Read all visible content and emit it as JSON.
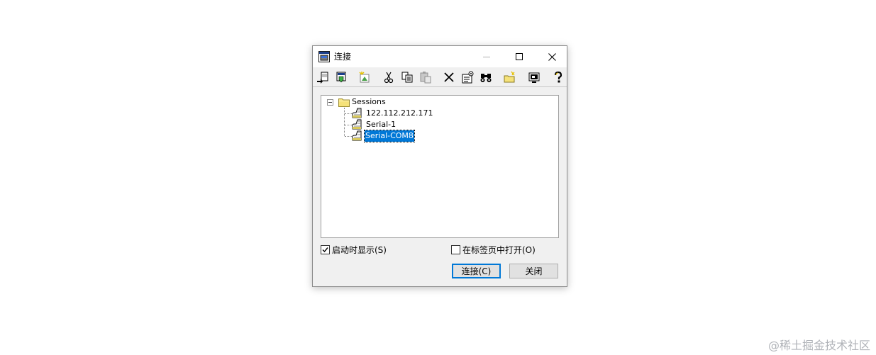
{
  "window": {
    "title": "连接"
  },
  "toolbar": {
    "buttons": [
      {
        "icon": "quick-connect-icon",
        "tooltip": ""
      },
      {
        "icon": "connect-tab-icon",
        "tooltip": ""
      },
      {
        "icon": "new-session-icon",
        "tooltip": ""
      },
      {
        "icon": "cut-icon",
        "tooltip": ""
      },
      {
        "icon": "copy-icon",
        "tooltip": ""
      },
      {
        "icon": "paste-icon",
        "tooltip": ""
      },
      {
        "icon": "delete-icon",
        "tooltip": ""
      },
      {
        "icon": "properties-icon",
        "tooltip": ""
      },
      {
        "icon": "find-icon",
        "tooltip": ""
      },
      {
        "icon": "new-folder-icon",
        "tooltip": ""
      },
      {
        "icon": "desktop-shortcut-icon",
        "tooltip": ""
      },
      {
        "icon": "help-icon",
        "tooltip": ""
      }
    ]
  },
  "tree": {
    "root": {
      "label": "Sessions",
      "expanded": true
    },
    "sessions": [
      {
        "label": "122.112.212.171",
        "selected": false
      },
      {
        "label": "Serial-1",
        "selected": false
      },
      {
        "label": "Serial-COM8",
        "selected": true
      }
    ]
  },
  "options": {
    "show_on_startup": {
      "label": "启动时显示(S)",
      "checked": true
    },
    "open_in_tab": {
      "label": "在标签页中打开(O)",
      "checked": false
    }
  },
  "buttons": {
    "connect": "连接(C)",
    "close": "关闭"
  },
  "watermark": "@稀土掘金技术社区",
  "colors": {
    "selection": "#0078d7",
    "default_button_border": "#0078d7",
    "dialog_bg": "#f0f0f0"
  }
}
